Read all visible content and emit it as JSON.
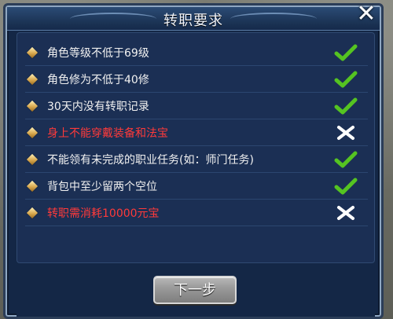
{
  "dialog": {
    "title": "转职要求",
    "close_icon": "✕",
    "requirements": [
      {
        "text": "角色等级不低于69级",
        "status": "pass"
      },
      {
        "text": "角色修为不低于40修",
        "status": "pass"
      },
      {
        "text": "30天内没有转职记录",
        "status": "pass"
      },
      {
        "text": "身上不能穿戴装备和法宝",
        "status": "fail"
      },
      {
        "text": "不能领有未完成的职业任务(如：师门任务)",
        "status": "pass"
      },
      {
        "text": "背包中至少留两个空位",
        "status": "pass"
      },
      {
        "text": "转职需消耗10000元宝",
        "status": "fail"
      }
    ],
    "next_label": "下一步"
  },
  "colors": {
    "pass": "#55c421",
    "fail": "#ffffff",
    "fail_text": "#ff3a3a",
    "normal_text": "#f1f1f1"
  },
  "icons": {
    "pass": "check-icon",
    "fail": "cross-icon",
    "bullet": "diamond-bullet-icon"
  }
}
